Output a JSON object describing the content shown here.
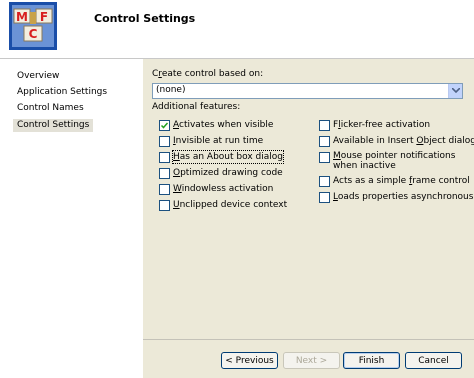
{
  "header": {
    "title": "Control Settings",
    "logo_letters": [
      "M",
      "F",
      "C"
    ]
  },
  "sidebar": {
    "items": [
      {
        "label": "Overview",
        "active": false
      },
      {
        "label": "Application Settings",
        "active": false
      },
      {
        "label": "Control Names",
        "active": false
      },
      {
        "label": "Control Settings",
        "active": true
      }
    ]
  },
  "main": {
    "create_label_pre": "C",
    "create_label_acc": "r",
    "create_label_post": "eate control based on:",
    "combo_value": "(none)",
    "additional_label": "Additional features:",
    "left_options": [
      {
        "pre": "",
        "acc": "A",
        "post": "ctivates when visible",
        "checked": true
      },
      {
        "pre": "",
        "acc": "I",
        "post": "nvisible at run time",
        "checked": false
      },
      {
        "pre": "",
        "acc": "H",
        "post": "as an About box dialog",
        "checked": false
      },
      {
        "pre": "",
        "acc": "O",
        "post": "ptimized drawing code",
        "checked": false
      },
      {
        "pre": "",
        "acc": "W",
        "post": "indowless activation",
        "checked": false
      },
      {
        "pre": "",
        "acc": "U",
        "post": "nclipped device context",
        "checked": false
      }
    ],
    "right_options": [
      {
        "pre": "F",
        "acc": "l",
        "post": "icker-free activation",
        "checked": false
      },
      {
        "pre": "Available in Insert ",
        "acc": "O",
        "post": "bject dialog",
        "checked": false
      },
      {
        "pre": "",
        "acc": "M",
        "post": "ouse pointer notifications when inactive",
        "checked": false
      },
      {
        "pre": "Acts as a simple ",
        "acc": "f",
        "post": "rame control",
        "checked": false
      },
      {
        "pre": "",
        "acc": "L",
        "post": "oads properties asynchronously",
        "checked": false
      }
    ]
  },
  "footer": {
    "previous": "< Previous",
    "next": "Next >",
    "finish": "Finish",
    "cancel": "Cancel"
  },
  "colors": {
    "accent": "#1c5180",
    "panel": "#ece9d8",
    "logo_red": "#d81f1f",
    "logo_blue": "#1a4ea8"
  }
}
